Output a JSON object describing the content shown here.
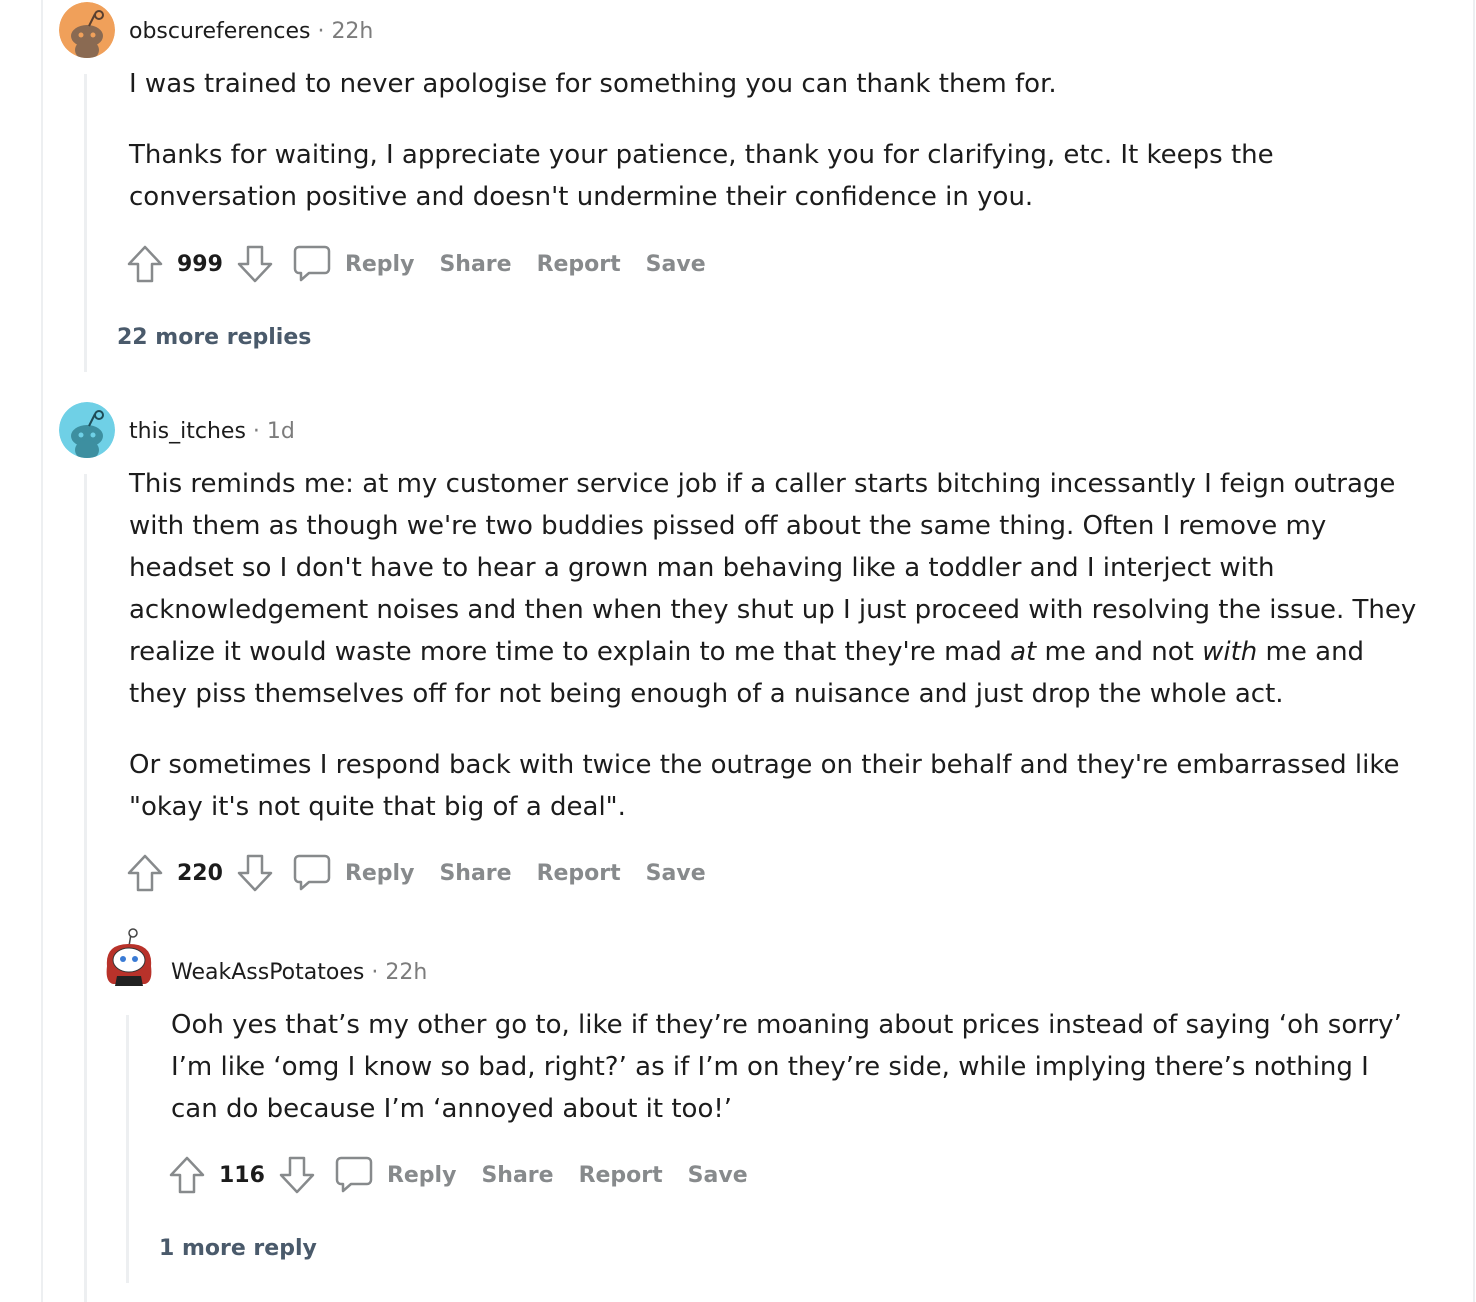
{
  "comments": [
    {
      "username": "obscureferences",
      "dot": "·",
      "time": "22h",
      "paragraphs": [
        "I was trained to never apologise for something you can thank them for.",
        "Thanks for waiting, I appreciate your patience, thank you for clarifying, etc. It keeps the conversation positive and doesn't undermine their confidence in you."
      ],
      "score": "999",
      "actions": {
        "reply": "Reply",
        "share": "Share",
        "report": "Report",
        "save": "Save"
      },
      "more_replies": "22 more replies",
      "avatar_color": "#f0a05a"
    },
    {
      "username": "this_itches",
      "dot": "·",
      "time": "1d",
      "paragraph1": {
        "part1": "This reminds me: at my customer service job if a caller starts bitching incessantly I feign outrage with them as though we're two buddies pissed off about the same thing. Often I remove my headset so I don't have to hear a grown man behaving like a toddler and I interject with acknowledgement noises and then when they shut up I just proceed with resolving the issue. They realize it would waste more time to explain to me that they're mad ",
        "em1": "at",
        "part2": " me and not ",
        "em2": "with",
        "part3": " me and they piss themselves off for not being enough of a nuisance and just drop the whole act."
      },
      "paragraph2": "Or sometimes I respond back with twice the outrage on their behalf and they're embarrassed like \"okay it's not quite that big of a deal\".",
      "score": "220",
      "actions": {
        "reply": "Reply",
        "share": "Share",
        "report": "Report",
        "save": "Save"
      },
      "avatar_color": "#6fd0e6"
    },
    {
      "username": "WeakAssPotatoes",
      "dot": "·",
      "time": "22h",
      "paragraphs": [
        "Ooh yes that’s my other go to, like if they’re moaning about prices instead of saying ‘oh sorry’ I’m like ‘omg I know so bad, right?’ as if I’m on they’re side, while implying there’s nothing I can do because I’m ‘annoyed about it too!’"
      ],
      "score": "116",
      "actions": {
        "reply": "Reply",
        "share": "Share",
        "report": "Report",
        "save": "Save"
      },
      "more_replies": "1 more reply"
    }
  ],
  "colors": {
    "text": "#1c1c1c",
    "meta": "#7c7c7c",
    "action": "#878a8c",
    "more": "#4a5a6b",
    "thread": "#edeff1"
  }
}
